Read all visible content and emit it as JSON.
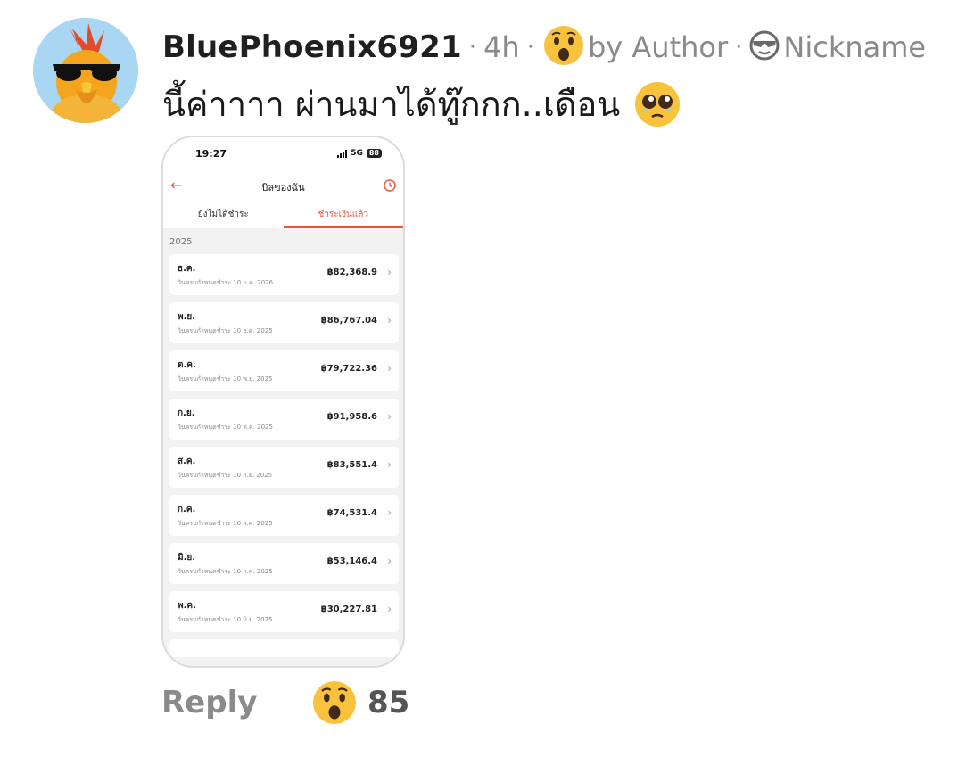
{
  "comment": {
    "username": "BluePhoenix6921",
    "time_ago": "4h",
    "author_label": "by Author",
    "nickname_label": "Nickname",
    "text": "นี้ค่าาาา ผ่านมาได้ทู๊กกก..เดือน"
  },
  "phone": {
    "status_time": "19:27",
    "network": "5G",
    "battery": "88",
    "title": "บิลของฉัน",
    "tabs": [
      "ยังไม่ได้ชำระ",
      "ชำระเงินแล้ว"
    ],
    "active_tab": "ชำระเงินแล้ว",
    "year": "2025",
    "bills": [
      {
        "month": "ธ.ค.",
        "due": "วันครบกำหนดชำระ 10 ม.ค. 2026",
        "amount": "฿82,368.9"
      },
      {
        "month": "พ.ย.",
        "due": "วันครบกำหนดชำระ 10 ธ.ค. 2025",
        "amount": "฿86,767.04"
      },
      {
        "month": "ต.ค.",
        "due": "วันครบกำหนดชำระ 10 พ.ย. 2025",
        "amount": "฿79,722.36"
      },
      {
        "month": "ก.ย.",
        "due": "วันครบกำหนดชำระ 10 ต.ค. 2025",
        "amount": "฿91,958.6"
      },
      {
        "month": "ส.ค.",
        "due": "วันครบกำหนดชำระ 10 ก.ย. 2025",
        "amount": "฿83,551.4"
      },
      {
        "month": "ก.ค.",
        "due": "วันครบกำหนดชำระ 10 ส.ค. 2025",
        "amount": "฿74,531.4"
      },
      {
        "month": "มิ.ย.",
        "due": "วันครบกำหนดชำระ 10 ก.ค. 2025",
        "amount": "฿53,146.4"
      },
      {
        "month": "พ.ค.",
        "due": "วันครบกำหนดชำระ 10 มิ.ย. 2025",
        "amount": "฿30,227.81"
      }
    ]
  },
  "actions": {
    "reply_label": "Reply",
    "reaction_count": "85"
  },
  "icons": {
    "avatar": "phoenix-sunglasses-avatar",
    "header_reaction": "surprised-face-emoji",
    "nickname": "sunglasses-face-icon",
    "comment_emoji": "pleading-face-emoji",
    "reaction": "surprised-face-emoji"
  },
  "colors": {
    "accent": "#e8553a",
    "muted_text": "#8a8a8a",
    "avatar_bg": "#a9d6f3"
  }
}
